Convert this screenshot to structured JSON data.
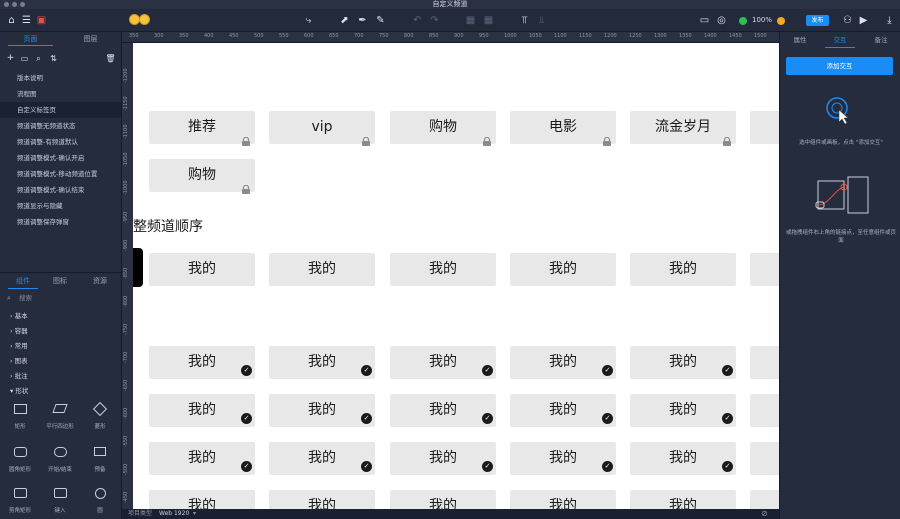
{
  "window": {
    "title": "自定义频道"
  },
  "toolbar": {
    "zoom": "100%",
    "publish_label": "发布"
  },
  "left_panel": {
    "tabs": [
      "页面",
      "图层"
    ],
    "pages": [
      "版本说明",
      "流程图",
      "自定义标签页",
      "频道调整无频道状态",
      "频道调整-有频道默认",
      "频道调整模式-确认开启",
      "频道调整模式-移动频道位置",
      "频道调整模式-确认结束",
      "频道显示与隐藏",
      "频道调整保存弹窗"
    ],
    "selected_page_index": 2,
    "library_tabs": [
      "组件",
      "图标",
      "资源"
    ],
    "search_placeholder": "搜索",
    "categories": [
      "基本",
      "容器",
      "常用",
      "图表",
      "批注",
      "形状"
    ],
    "shapes": [
      [
        "矩形",
        "平行四边形",
        "菱形"
      ],
      [
        "圆角矩形",
        "开始/结束",
        "预备"
      ],
      [
        "剪角矩形",
        "键入",
        "圆"
      ]
    ]
  },
  "ruler": {
    "h_ticks": [
      "350",
      "300",
      "350",
      "400",
      "450",
      "500",
      "550",
      "600",
      "650",
      "700",
      "750",
      "800",
      "850",
      "900",
      "950",
      "1000",
      "1050",
      "1100",
      "1150",
      "1200",
      "1250",
      "1300",
      "1350",
      "1400",
      "1450",
      "1500",
      "1550"
    ],
    "v_ticks": [
      "-1200",
      "-1150",
      "-1100",
      "-1050",
      "-1000",
      "-950",
      "-900",
      "-850",
      "-800",
      "-750",
      "-700",
      "-650",
      "-600",
      "-550",
      "-500",
      "-450"
    ]
  },
  "canvas": {
    "section_heading": "整频道顺序",
    "row1": [
      {
        "label": "推荐",
        "icon": "lock-icon"
      },
      {
        "label": "vip",
        "icon": "lock-icon"
      },
      {
        "label": "购物",
        "icon": "lock-icon"
      },
      {
        "label": "电影",
        "icon": "lock-icon"
      },
      {
        "label": "流金岁月",
        "icon": "lock-icon"
      }
    ],
    "row2": [
      {
        "label": "购物",
        "icon": "lock-icon"
      }
    ],
    "plain_row": [
      "我的",
      "我的",
      "我的",
      "我的",
      "我的"
    ],
    "check_rows": [
      [
        "我的",
        "我的",
        "我的",
        "我的",
        "我的"
      ],
      [
        "我的",
        "我的",
        "我的",
        "我的",
        "我的"
      ],
      [
        "我的",
        "我的",
        "我的",
        "我的",
        "我的"
      ],
      [
        "我的",
        "我的",
        "我的",
        "我的",
        "我的"
      ]
    ]
  },
  "right_panel": {
    "tabs": [
      "属性",
      "交互",
      "备注"
    ],
    "active_tab": "交互",
    "add_interaction_label": "添加交互",
    "hint1": "选中组件或画板，点击 \"添加交互\"",
    "hint2": "或拖拽组件右上角的链接点，至任意组件或页面"
  },
  "status_bar": {
    "project_type_label": "项目类型",
    "project_type_value": "Web 1920"
  },
  "colors": {
    "accent": "#1c8cf5",
    "card_bg": "#e8e8e8",
    "panel_bg": "#252c3d"
  }
}
